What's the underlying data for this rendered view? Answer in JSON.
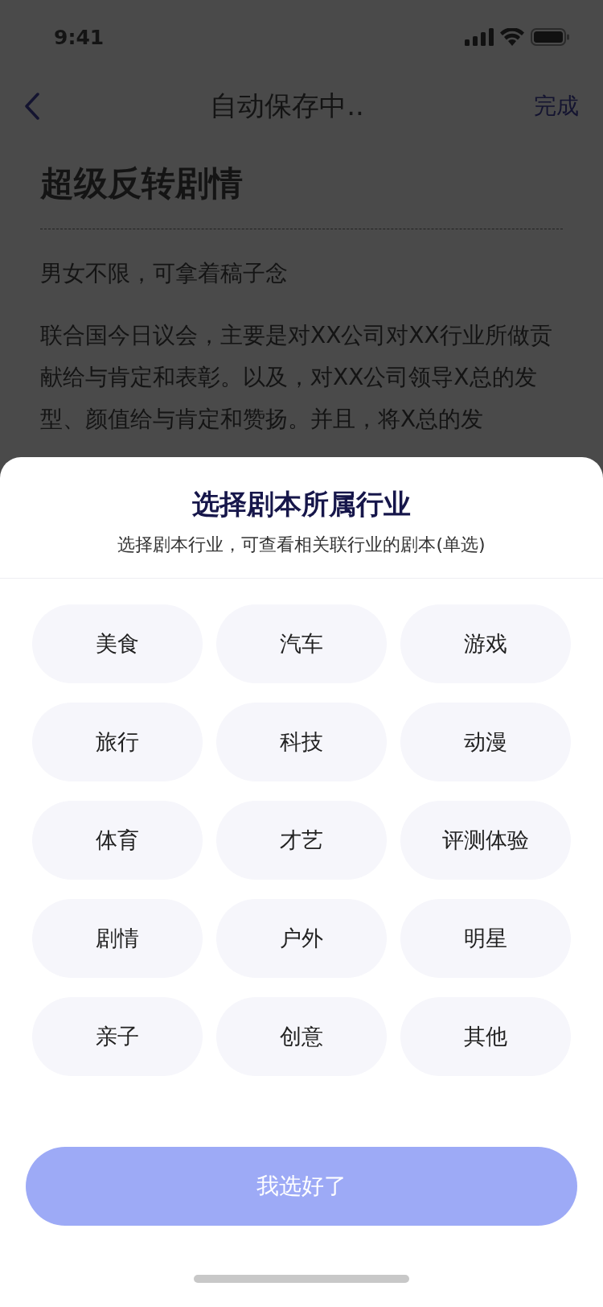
{
  "status_bar": {
    "time": "9:41"
  },
  "nav": {
    "title": "自动保存中..",
    "action": "完成"
  },
  "script": {
    "title": "超级反转剧情",
    "note": "男女不限，可拿着稿子念",
    "body": "联合国今日议会，主要是对XX公司对XX行业所做贡献给与肯定和表彰。以及，对XX公司领导X总的发型、颜值给与肯定和赞扬。并且，将X总的发"
  },
  "sheet": {
    "title": "选择剧本所属行业",
    "subtitle": "选择剧本行业，可查看相关联行业的剧本(单选)",
    "options": [
      {
        "label": "美食",
        "selected": false
      },
      {
        "label": "汽车",
        "selected": false
      },
      {
        "label": "游戏",
        "selected": false
      },
      {
        "label": "旅行",
        "selected": false
      },
      {
        "label": "科技",
        "selected": false
      },
      {
        "label": "动漫",
        "selected": false
      },
      {
        "label": "体育",
        "selected": false
      },
      {
        "label": "才艺",
        "selected": false
      },
      {
        "label": "评测体验",
        "selected": false
      },
      {
        "label": "剧情",
        "selected": false
      },
      {
        "label": "户外",
        "selected": false
      },
      {
        "label": "明星",
        "selected": false
      },
      {
        "label": "亲子",
        "selected": false
      },
      {
        "label": "创意",
        "selected": false
      },
      {
        "label": "其他",
        "selected": false
      }
    ],
    "confirm": {
      "label": "我选好了",
      "disabled": true
    }
  }
}
